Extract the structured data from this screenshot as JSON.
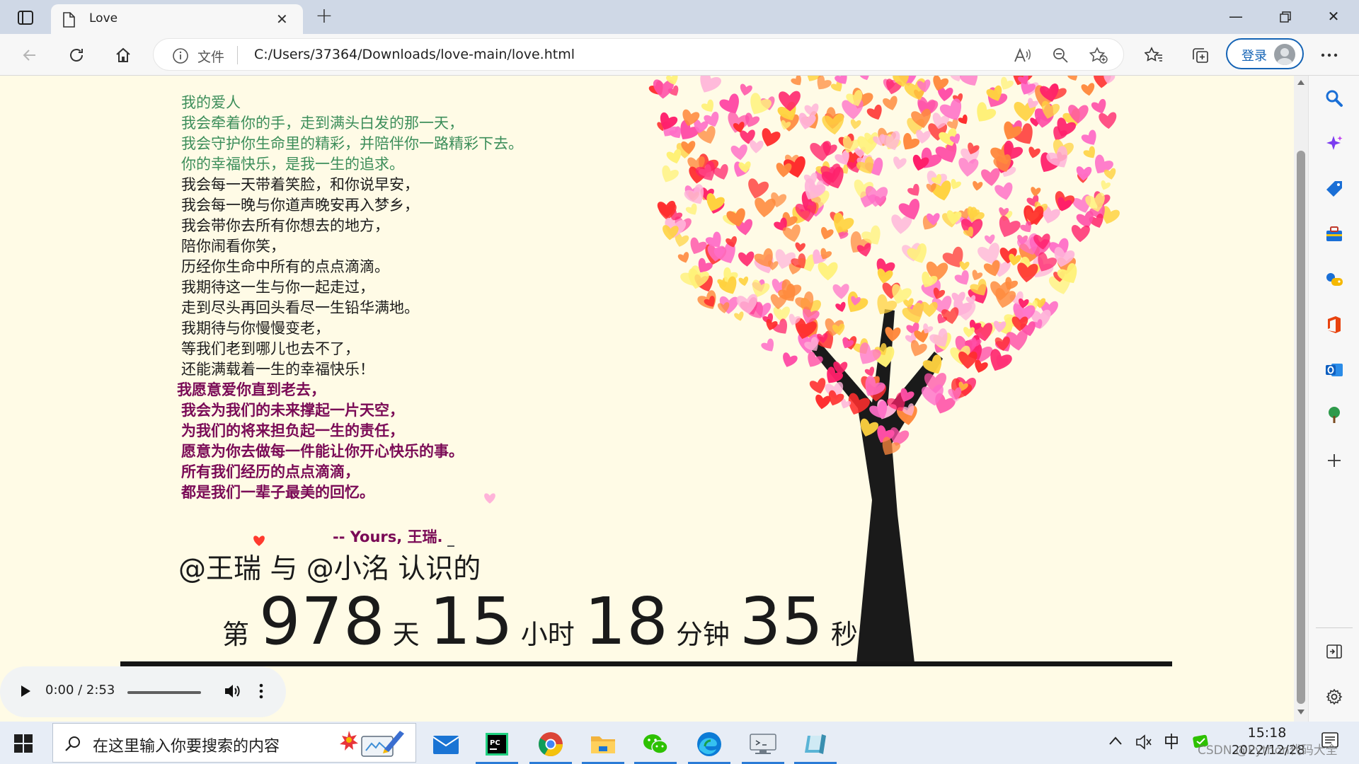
{
  "browser": {
    "tab_title": "Love",
    "address_label": "文件",
    "url": "C:/Users/37364/Downloads/love-main/love.html",
    "login_label": "登录"
  },
  "poem": {
    "green_lines": [
      "我的爱人",
      "我会牵着你的手，走到满头白发的那一天，",
      "我会守护你生命里的精彩，并陪伴你一路精彩下去。",
      "你的幸福快乐，是我一生的追求。"
    ],
    "black_lines": [
      "我会每一天带着笑脸，和你说早安，",
      "我会每一晚与你道声晚安再入梦乡，",
      "我会带你去所有你想去的地方，",
      "陪你闹看你笑，",
      "历经你生命中所有的点点滴滴。",
      "我期待这一生与你一起走过，",
      "走到尽头再回头看尽一生铅华满地。",
      "我期待与你慢慢变老，",
      "等我们老到哪儿也去不了，",
      "还能满载着一生的幸福快乐！"
    ],
    "bold_lines": [
      "我愿意爱你直到老去，",
      "我会为我们的未来撑起一片天空，",
      "为我们的将来担负起一生的责任，",
      "愿意为你去做每一件能让你开心快乐的事。",
      "所有我们经历的点点滴滴，",
      "都是我们一辈子最美的回忆。"
    ],
    "signature": "-- Yours, 王瑞."
  },
  "names_line": "@王瑞 与 @小洺 认识的",
  "counter": {
    "prefix": "第",
    "days": "978",
    "days_unit": "天",
    "hours": "15",
    "hours_unit": "小时",
    "minutes": "18",
    "minutes_unit": "分钟",
    "seconds": "35",
    "seconds_unit": "秒"
  },
  "audio": {
    "time": "0:00 / 2:53"
  },
  "taskbar": {
    "search_placeholder": "在这里输入你要搜索的内容",
    "time": "15:18",
    "date": "2022/12/28"
  },
  "watermark": "CSDN @Python代码大全",
  "colors": {
    "page_bg": "#fffbe6",
    "green_text": "#3c8e5a",
    "bold_text": "#7a0a56",
    "trunk": "#1a1a1a",
    "heart_palette": [
      "#ff1f6a",
      "#ff4fa7",
      "#ff8a3d",
      "#ffd23f",
      "#ff6ec7",
      "#ff2e2e",
      "#ffb3d9",
      "#fff176"
    ]
  }
}
